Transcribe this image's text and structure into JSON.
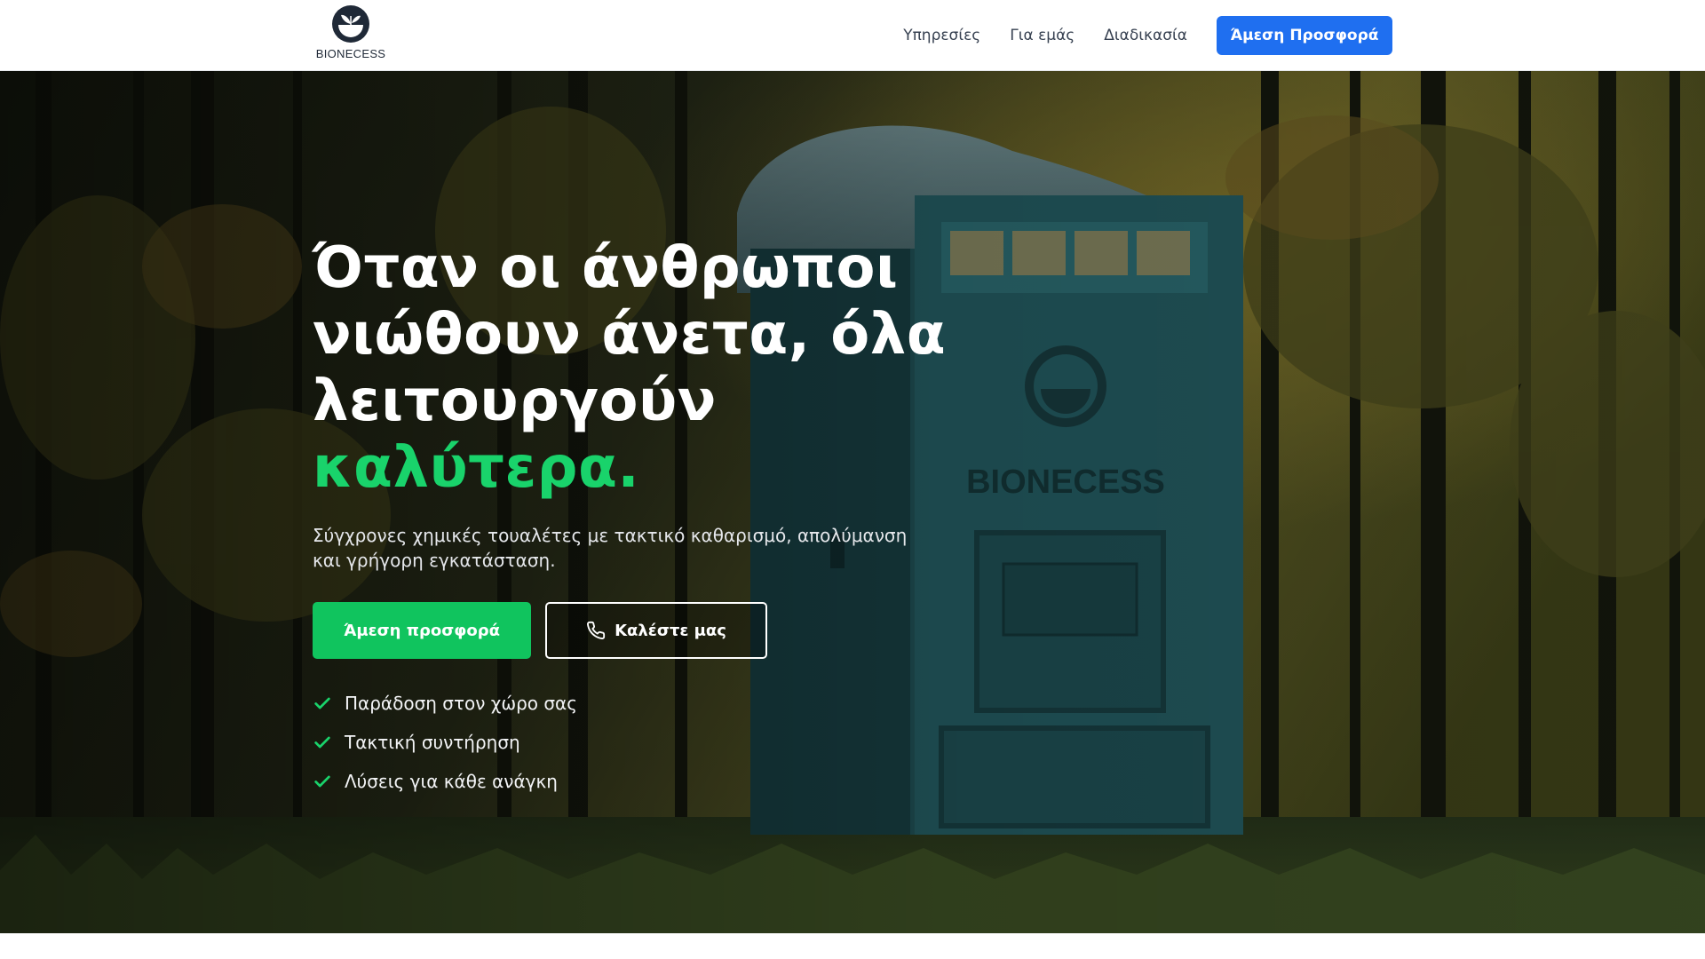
{
  "brand": {
    "name": "BIONECESS"
  },
  "nav": {
    "items": [
      {
        "label": "Υπηρεσίες"
      },
      {
        "label": "Για εμάς"
      },
      {
        "label": "Διαδικασία"
      }
    ],
    "cta_label": "Άμεση Προσφορά"
  },
  "hero": {
    "headline_line1": "Όταν οι άνθρωποι",
    "headline_line2": "νιώθουν άνετα, όλα",
    "headline_line3": "λειτουργούν ",
    "headline_accent": "καλύτερα.",
    "subtitle": "Σύγχρονες χημικές τουαλέτες με τακτικό καθαρισμό, απολύμανση και γρήγορη εγκατάσταση.",
    "primary_button": "Άμεση προσφορά",
    "secondary_button": "Καλέστε μας",
    "secondary_button_icon": "phone-icon",
    "features": [
      {
        "label": "Παράδοση στον χώρο σας",
        "icon": "check-icon"
      },
      {
        "label": "Τακτική συντήρηση",
        "icon": "check-icon"
      },
      {
        "label": "Λύσεις για κάθε ανάγκη",
        "icon": "check-icon"
      }
    ]
  },
  "colors": {
    "accent_green": "#19d36b",
    "button_green": "#10c45e",
    "nav_cta_blue": "#1f6ff0",
    "cabin_teal": "#1f4f54"
  }
}
